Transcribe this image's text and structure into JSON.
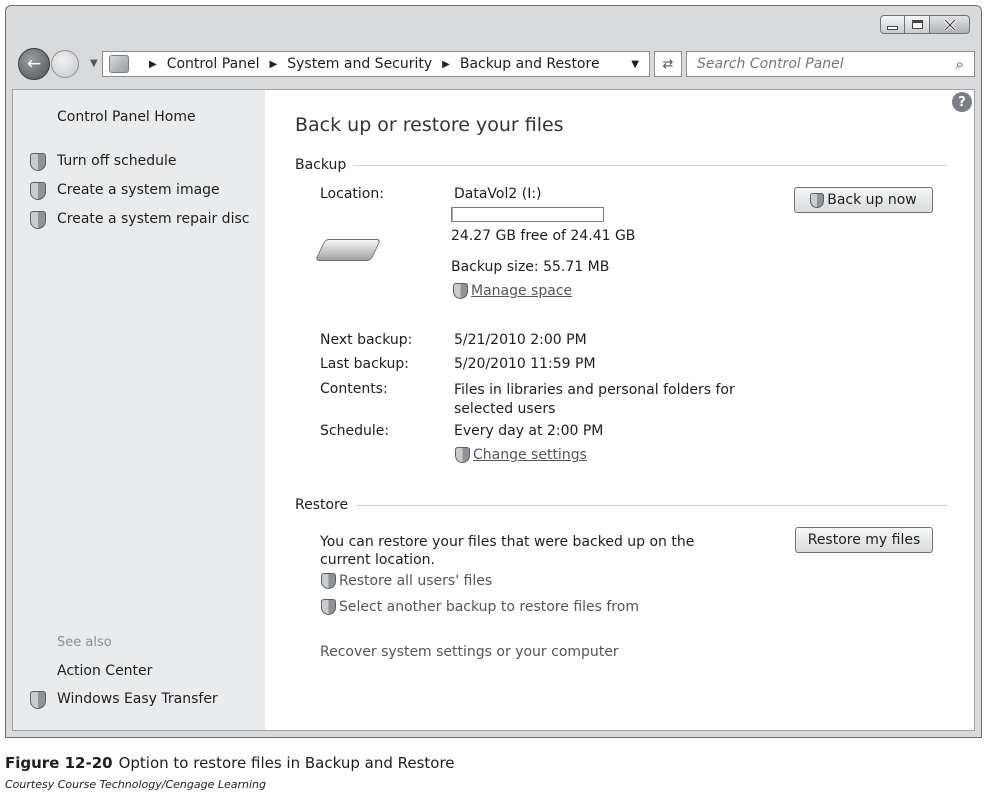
{
  "address_bar": {
    "crumbs": [
      "Control Panel",
      "System and Security",
      "Backup and Restore"
    ],
    "search_placeholder": "Search Control Panel"
  },
  "left_pane": {
    "home": "Control Panel Home",
    "tasks": [
      "Turn off schedule",
      "Create a system image",
      "Create a system repair disc"
    ],
    "see_also_heading": "See also",
    "see_also": [
      "Action Center",
      "Windows Easy Transfer"
    ]
  },
  "main": {
    "title": "Back up or restore your files",
    "backup": {
      "heading": "Backup",
      "location_label": "Location:",
      "location_value": "DataVol2 (I:)",
      "free_space": "24.27 GB free of 24.41 GB",
      "used_fraction": 0.006,
      "backup_size": "Backup size: 55.71 MB",
      "manage_space": "Manage space",
      "back_up_now": "Back up now",
      "next_backup_label": "Next backup:",
      "next_backup_value": "5/21/2010 2:00 PM",
      "last_backup_label": "Last backup:",
      "last_backup_value": "5/20/2010 11:59 PM",
      "contents_label": "Contents:",
      "contents_value": "Files in libraries and personal folders for selected users",
      "schedule_label": "Schedule:",
      "schedule_value": "Every day at 2:00 PM",
      "change_settings": "Change settings"
    },
    "restore": {
      "heading": "Restore",
      "description": "You can restore your files that were backed up on the current location.",
      "restore_my_files": "Restore my files",
      "restore_all_users": "Restore all users' files",
      "select_another": "Select another backup to restore files from",
      "recover_system": "Recover system settings or your computer"
    }
  },
  "figure": {
    "label": "Figure 12-20",
    "caption": "Option to restore files in Backup and Restore",
    "credit": "Courtesy Course Technology/Cengage Learning"
  },
  "icons": [
    "back-arrow-icon",
    "forward-arrow-icon",
    "control-panel-icon",
    "refresh-icon",
    "search-icon",
    "help-icon",
    "shield-icon",
    "drive-icon"
  ]
}
